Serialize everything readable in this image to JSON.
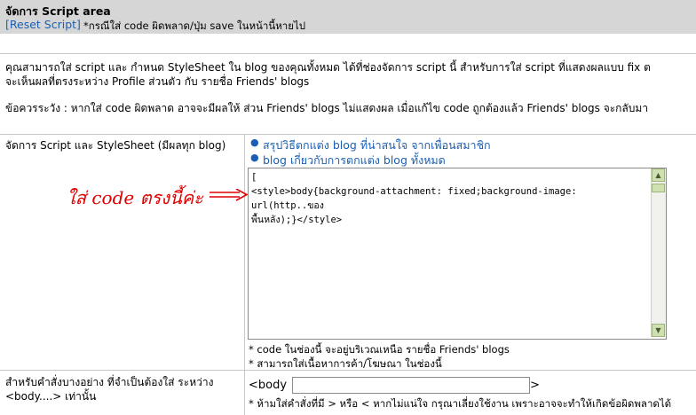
{
  "header": {
    "title": "จัดการ Script area",
    "reset_label": "[Reset Script]",
    "note": "*กรณีใส่ code ผิดพลาด/ปุ่ม save ในหน้านี้หายไป"
  },
  "description": {
    "line1": "คุณสามารถใส่ script และ กำหนด StyleSheet ใน blog ของคุณทั้งหมด ได้ที่ช่องจัดการ script นี้ สำหรับการใส่ script ที่แสดงผลแบบ fix ต",
    "line2": "จะเห็นผลที่ตรงระหว่าง Profile ส่วนตัว กับ รายชื่อ Friends' blogs",
    "line3": "ข้อควรระวัง : หากใส่ code ผิดพลาด อาจจะมีผลให้ ส่วน Friends' blogs ไม่แสดงผล เมื่อแก้ไข code ถูกต้องแล้ว Friends' blogs จะกลับมา"
  },
  "script_section": {
    "label": "จัดการ Script และ StyleSheet (มีผลทุก blog)",
    "links": [
      "สรุปวิธีตกแต่ง blog ที่น่าสนใจ จากเพื่อนสมาชิก",
      "blog เกี่ยวกับการตกแต่ง blog ทั้งหมด"
    ],
    "editor_value": "[\n<style>body{background-attachment: fixed;background-image: url(http..ของ\nพื้นหลัง);}</style>",
    "annotation": "ใส่ code ตรงนี้ค่ะ",
    "hints": [
      "* code ในช่องนี้ จะอยู่บริเวณเหนือ รายชื่อ Friends' blogs",
      "* สามารถใส่เนื้อหาการค้า/โฆษณา ในช่องนี้"
    ]
  },
  "body_section": {
    "label_line1": "สำหรับคำสั่งบางอย่าง ที่จำเป็นต้องใส่ ระหว่าง",
    "label_line2": "<body....> เท่านั้น",
    "open_tag": "<body",
    "input_value": "",
    "close_tag": ">",
    "warning": "* ห้ามใส่คำสั่งที่มี > หรือ < หากไม่แน่ใจ กรุณาเลี่ยงใช้งาน เพราะอาจจะทำให้เกิดข้อผิดพลาดได้"
  },
  "colors": {
    "link": "#1a5fb4",
    "annotation": "#e00000",
    "header_bg": "#d6d6d6"
  }
}
